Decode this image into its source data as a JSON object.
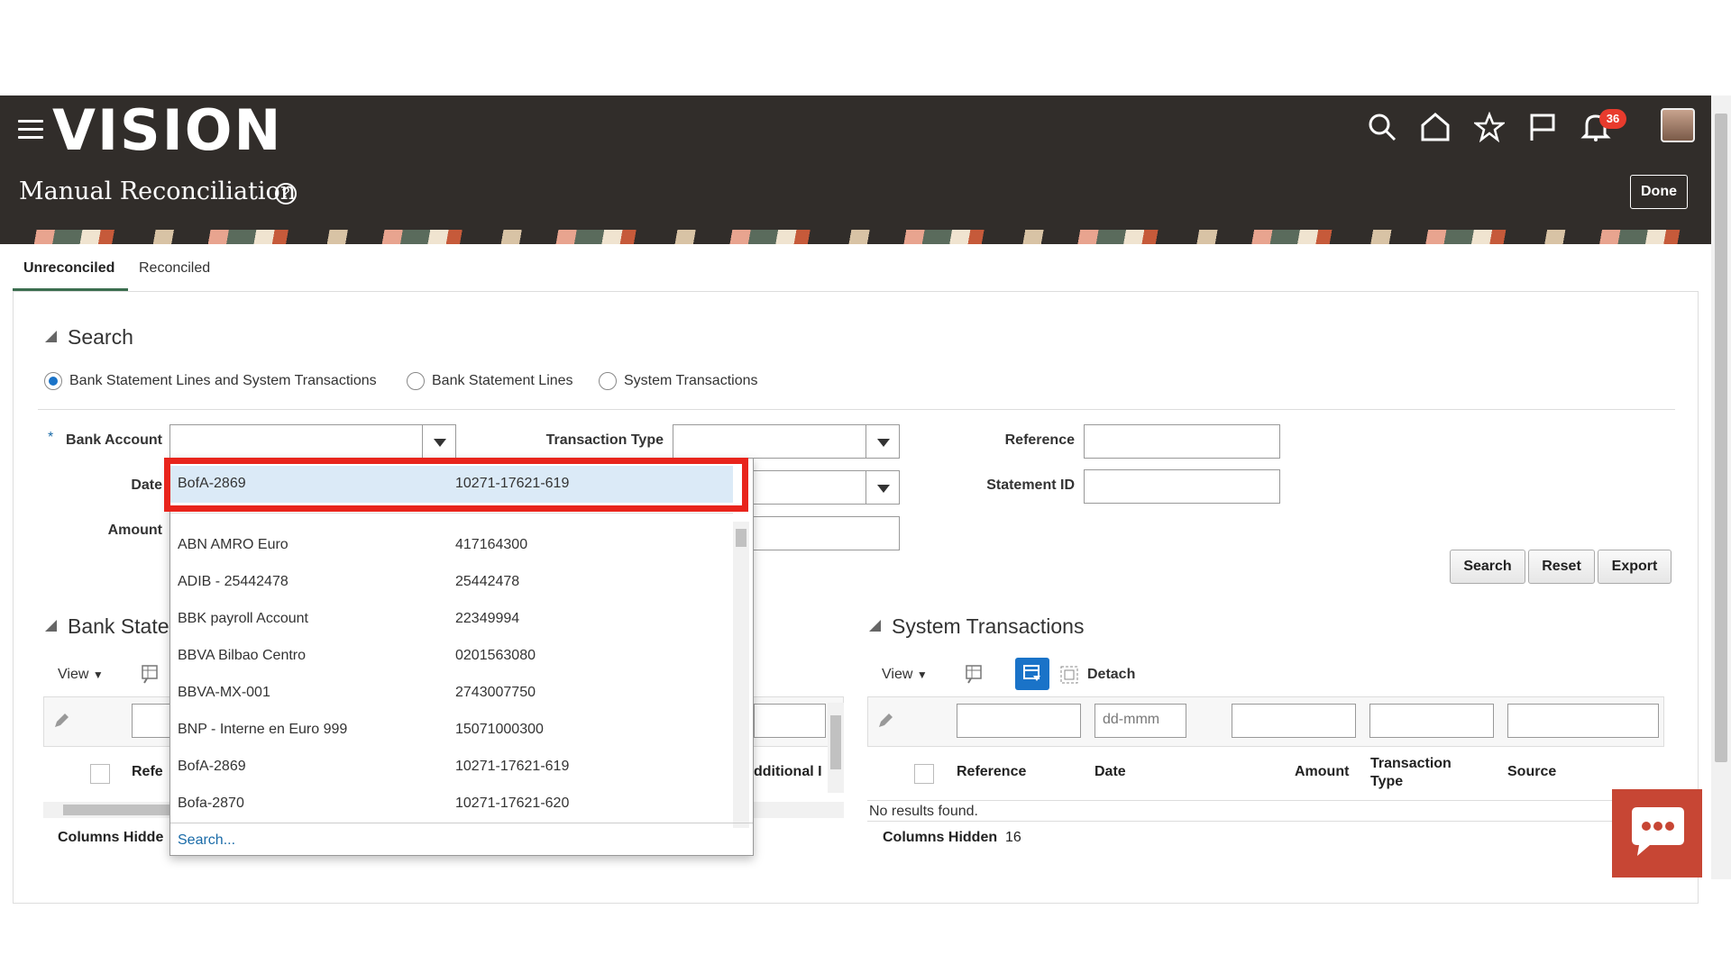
{
  "header": {
    "logo": "VISION",
    "page_title": "Manual Reconciliation",
    "notification_count": "36",
    "done_label": "Done"
  },
  "tabs": [
    {
      "label": "Unreconciled",
      "active": true
    },
    {
      "label": "Reconciled",
      "active": false
    }
  ],
  "search": {
    "title": "Search",
    "radio_options": [
      {
        "label": "Bank Statement Lines and System Transactions",
        "selected": true
      },
      {
        "label": "Bank Statement Lines",
        "selected": false
      },
      {
        "label": "System Transactions",
        "selected": false
      }
    ],
    "required_mark": "*",
    "fields": {
      "bank_account": "Bank Account",
      "date": "Date",
      "amount": "Amount",
      "transaction_type": "Transaction Type",
      "reference": "Reference",
      "statement_id": "Statement ID"
    },
    "buttons": {
      "search": "Search",
      "reset": "Reset",
      "export": "Export"
    }
  },
  "bank_dropdown": {
    "selected": {
      "name": "BofA-2869",
      "number": "10271-17621-619"
    },
    "options": [
      {
        "name": "ABN AMRO Euro",
        "number": "417164300"
      },
      {
        "name": "ADIB - 25442478",
        "number": "25442478"
      },
      {
        "name": "BBK payroll Account",
        "number": "22349994"
      },
      {
        "name": "BBVA Bilbao Centro",
        "number": "0201563080"
      },
      {
        "name": "BBVA-MX-001",
        "number": "2743007750"
      },
      {
        "name": "BNP - Interne en Euro 999",
        "number": "15071000300"
      },
      {
        "name": "BofA-2869",
        "number": "10271-17621-619"
      },
      {
        "name": "Bofa-2870",
        "number": "10271-17621-620"
      }
    ],
    "search_link": "Search..."
  },
  "bank_statement_table": {
    "title": "Bank Stater",
    "view_label": "View",
    "col_reference": "Refe",
    "col_additional": "dditional I",
    "columns_hidden_label": "Columns Hidde"
  },
  "system_transactions": {
    "title": "System Transactions",
    "view_label": "View",
    "detach_label": "Detach",
    "date_placeholder": "dd-mmm",
    "columns": [
      "Reference",
      "Date",
      "Amount",
      "Transaction Type",
      "Source"
    ],
    "empty_text": "No results found.",
    "columns_hidden_label": "Columns Hidden",
    "columns_hidden_count": "16"
  }
}
